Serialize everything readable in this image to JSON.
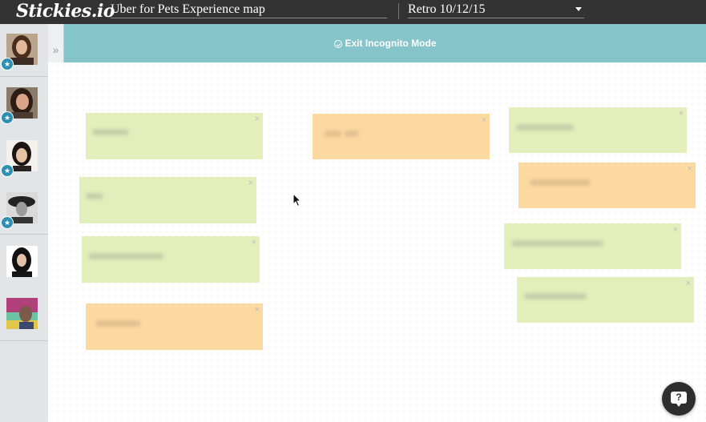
{
  "app": {
    "logo_text": "Stickies.io",
    "board_title": "Uber for Pets Experience map",
    "retro_select": "Retro 10/12/15"
  },
  "sidebar": {
    "collapse_glyph": "»",
    "star_glyph": "★",
    "avatars": [
      {
        "name": "avatar-1",
        "starred": true
      },
      {
        "name": "avatar-2",
        "starred": true
      },
      {
        "name": "avatar-3",
        "starred": true
      },
      {
        "name": "avatar-4",
        "starred": true
      },
      {
        "name": "avatar-5",
        "starred": false
      },
      {
        "name": "avatar-6",
        "starred": false
      }
    ]
  },
  "banner": {
    "text": "Exit Incognito Mode",
    "icon": "check-circle-icon",
    "color": "#86c4cb"
  },
  "board": {
    "close_glyph": "×",
    "colors": {
      "green": "#e3efbb",
      "orange": "#fcd9a1"
    }
  },
  "help": {
    "label": "?",
    "icon": "help-chat-icon"
  }
}
